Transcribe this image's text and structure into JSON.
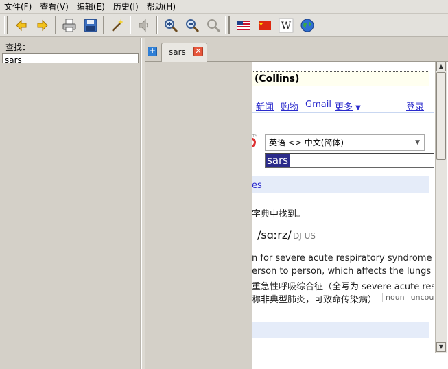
{
  "menu": [
    "文件(F)",
    "查看(V)",
    "编辑(E)",
    "历史(I)",
    "帮助(H)"
  ],
  "toolbar": {
    "buttons": [
      "back-icon",
      "forward-icon",
      "print-icon",
      "save-icon",
      "wand-icon",
      "speaker-icon",
      "zoom-in-icon",
      "zoom-out-icon",
      "zoom-reset-icon",
      "us-flag-icon",
      "cn-flag-icon",
      "wikipedia-icon",
      "globe-icon"
    ]
  },
  "left": {
    "find_label": "查找：",
    "find_value": "sars"
  },
  "tab": {
    "label": "sars"
  },
  "web": {
    "collins": "(Collins)",
    "nav": {
      "news": "新闻",
      "shopping": "购物",
      "gmail": "Gmail",
      "more": "更多",
      "more_arrow": "▼",
      "login": "登录"
    },
    "language": "英语 <> 中文(简体)",
    "query": "sars",
    "result_link": "es",
    "not_found": "字典中找到。",
    "phonetic": "/sɑːrz/",
    "phonetic_tags": "DJ US",
    "def_lines": [
      "n for severe acute respiratory syndrome (an i",
      "erson to person, which affects the lungs and c",
      "重急性呼吸综合征（全写为 severe acute res",
      "称非典型肺炎，可致命传染病）"
    ],
    "pos": [
      "noun",
      "uncoun"
    ]
  },
  "colors": {
    "chrome": "#d4d0c8",
    "link": "#2a2acc",
    "highlight": "#2b2b8a",
    "close": "#e6553a"
  }
}
